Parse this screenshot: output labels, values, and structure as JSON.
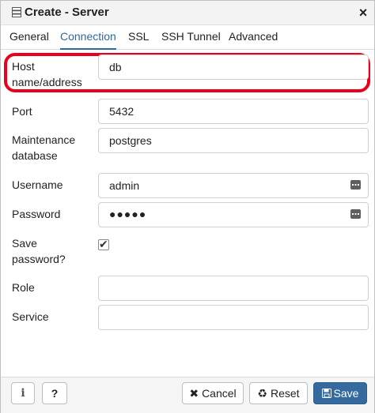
{
  "dialog": {
    "title": "Create - Server",
    "close_glyph": "×",
    "icon": "server-icon"
  },
  "tabs": [
    {
      "label": "General",
      "active": false
    },
    {
      "label": "Connection",
      "active": true
    },
    {
      "label": "SSL",
      "active": false
    },
    {
      "label": "SSH Tunnel",
      "active": false
    },
    {
      "label": "Advanced",
      "active": false
    }
  ],
  "form": {
    "host": {
      "label_line1": "Host",
      "label_line2": "name/address",
      "value": "db"
    },
    "port": {
      "label": "Port",
      "value": "5432"
    },
    "maintenance_db": {
      "label_line1": "Maintenance",
      "label_line2": "database",
      "value": "postgres"
    },
    "username": {
      "label": "Username",
      "value": "admin"
    },
    "password": {
      "label": "Password",
      "masked_value": "●●●●●"
    },
    "save_password": {
      "label_line1": "Save",
      "label_line2": "password?",
      "checked": true
    },
    "role": {
      "label": "Role",
      "value": ""
    },
    "service": {
      "label": "Service",
      "value": ""
    }
  },
  "footer": {
    "info_label": "i",
    "help_label": "?",
    "cancel_label": "Cancel",
    "reset_label": "Reset",
    "save_label": "Save"
  },
  "colors": {
    "accent": "#2c6a9e",
    "highlight": "#e8001c",
    "save_button": "#356a9e"
  }
}
